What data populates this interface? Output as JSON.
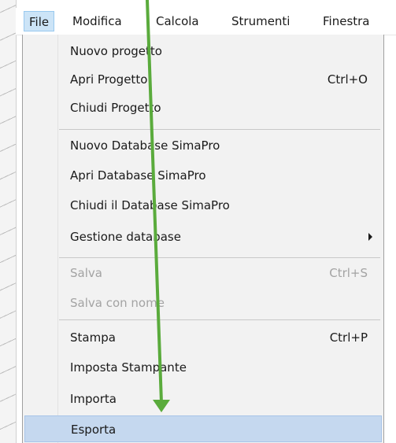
{
  "menubar": {
    "items": [
      "File",
      "Modifica",
      "Calcola",
      "Strumenti",
      "Finestra"
    ]
  },
  "file_menu": {
    "groups": [
      {
        "items": [
          {
            "label": "Nuovo progetto",
            "shortcut": ""
          },
          {
            "label": "Apri Progetto",
            "shortcut": "Ctrl+O"
          },
          {
            "label": "Chiudi Progetto",
            "shortcut": ""
          }
        ]
      },
      {
        "items": [
          {
            "label": "Nuovo Database SimaPro",
            "shortcut": ""
          },
          {
            "label": "Apri Database SimaPro",
            "shortcut": ""
          },
          {
            "label": "Chiudi il Database SimaPro",
            "shortcut": ""
          },
          {
            "label": "Gestione database",
            "shortcut": "",
            "submenu": true
          }
        ]
      },
      {
        "items": [
          {
            "label": "Salva",
            "shortcut": "Ctrl+S",
            "disabled": true
          },
          {
            "label": "Salva con nome",
            "shortcut": "",
            "disabled": true
          }
        ]
      },
      {
        "items": [
          {
            "label": "Stampa",
            "shortcut": "Ctrl+P"
          },
          {
            "label": "Imposta Stampante",
            "shortcut": ""
          },
          {
            "label": "Importa",
            "shortcut": ""
          },
          {
            "label": "Esporta",
            "shortcut": "",
            "highlighted": true
          }
        ]
      }
    ]
  },
  "annotation": {
    "arrow_color": "#5aab3c"
  },
  "colors": {
    "menu_background": "#f2f2f2",
    "highlight": "#c5d8ef",
    "disabled_text": "#a3a3a3"
  }
}
